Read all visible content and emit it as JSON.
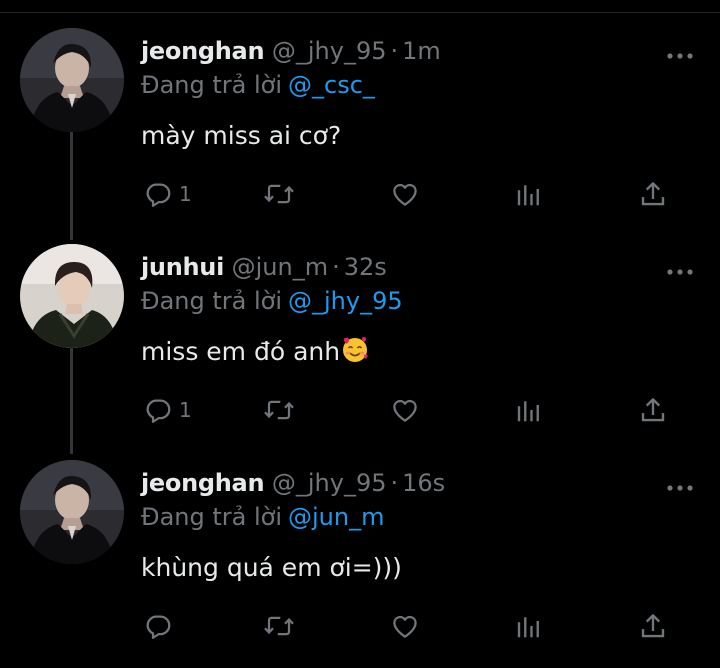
{
  "tweets": [
    {
      "name": "jeonghan",
      "handle": "@_jhy_95",
      "separator": "·",
      "time": "1m",
      "reply_prefix": "Đang trả lời",
      "reply_to": "@_csc_",
      "text": "mày miss ai cơ?",
      "reply_count": "1",
      "avatar_icon": "avatar-jeonghan"
    },
    {
      "name": "junhui",
      "handle": "@jun_m",
      "separator": "·",
      "time": "32s",
      "reply_prefix": "Đang trả lời",
      "reply_to": "@_jhy_95",
      "text": "miss em đó anh",
      "emoji": "smiling-face-with-hearts",
      "reply_count": "1",
      "avatar_icon": "avatar-junhui"
    },
    {
      "name": "jeonghan",
      "handle": "@_jhy_95",
      "separator": "·",
      "time": "16s",
      "reply_prefix": "Đang trả lời",
      "reply_to": "@jun_m",
      "text": "khùng quá em ơi=)))",
      "reply_count": "",
      "avatar_icon": "avatar-jeonghan"
    }
  ],
  "icons": {
    "more": "more-horizontal-icon",
    "reply": "reply-icon",
    "retweet": "retweet-icon",
    "like": "heart-icon",
    "views": "views-icon",
    "share": "share-icon"
  },
  "colors": {
    "background": "#000000",
    "text": "#e7e9ea",
    "secondary": "#71767b",
    "mention": "#1d9bf0",
    "thread_line": "#333639"
  }
}
